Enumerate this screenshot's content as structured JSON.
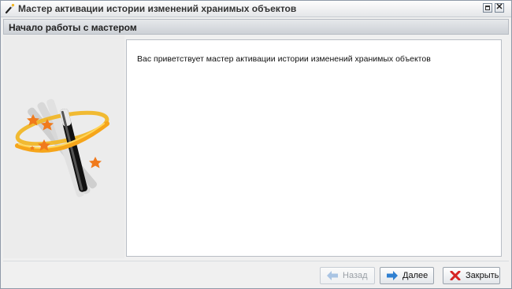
{
  "window": {
    "title": "Мастер активации истории изменений хранимых объектов",
    "title_icon": "magic-wand-icon",
    "maximize_icon": "maximize-icon",
    "close_icon": "close-icon",
    "close_glyph": "✕"
  },
  "header": {
    "title": "Начало работы с мастером"
  },
  "left_panel": {
    "illustration": "magic-wand-illustration"
  },
  "content": {
    "welcome_text": "Вас приветствует мастер активации истории изменений хранимых объектов"
  },
  "buttons": {
    "back": {
      "label": "Назад",
      "icon": "arrow-left-icon",
      "enabled": false
    },
    "next": {
      "label": "Далее",
      "icon": "arrow-right-icon",
      "enabled": true
    },
    "close": {
      "label": "Закрыть",
      "icon": "close-x-icon",
      "enabled": true
    }
  },
  "colors": {
    "accent_blue": "#2f7fd1",
    "close_red": "#d62424",
    "star_orange": "#f07a1c",
    "ring_gold": "#f2b51e"
  }
}
